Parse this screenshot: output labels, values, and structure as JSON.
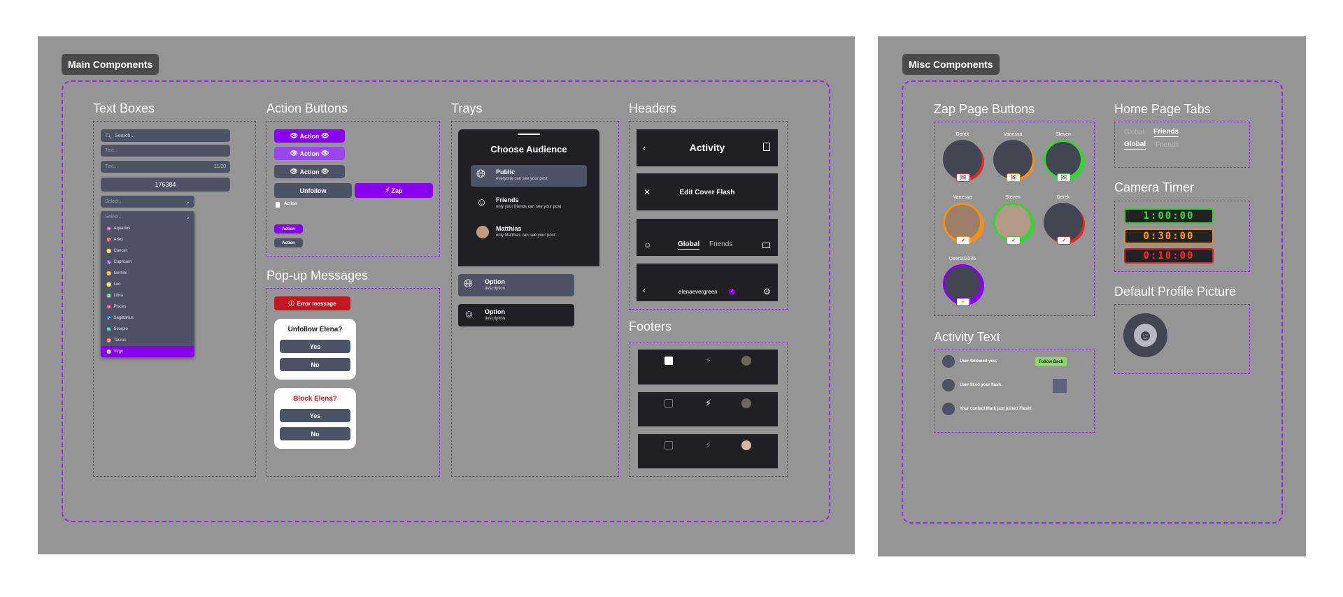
{
  "main": {
    "label": "Main Components",
    "text_boxes": {
      "title": "Text Boxes",
      "search_placeholder": "Search...",
      "text1_placeholder": "Text...",
      "text2_placeholder": "Text...",
      "counter": "11/20",
      "number_value": "176384",
      "select_placeholder": "Select...",
      "list_select_placeholder": "Select...",
      "options": [
        "Aquarius",
        "Aries",
        "Cancer",
        "Capricorn",
        "Gemini",
        "Leo",
        "Libra",
        "Pisces",
        "Sagittarius",
        "Scorpio",
        "Taurus",
        "Virgo"
      ],
      "option_icons": [
        "♒",
        "♈",
        "♋",
        "♑",
        "♊",
        "♌",
        "♎",
        "♓",
        "♐",
        "♏",
        "♉",
        "♍"
      ]
    },
    "action_buttons": {
      "title": "Action Buttons",
      "action1": "Action",
      "action2": "Action",
      "action3": "Action",
      "unfollow": "Unfollow",
      "zap": "Zap",
      "checkbox_label": "Action",
      "small_purple": "Action",
      "small_gray": "Action"
    },
    "popups": {
      "title": "Pop-up Messages",
      "error": "Error message",
      "unfollow_title": "Unfollow Elena?",
      "yes1": "Yes",
      "no1": "No",
      "block_title": "Block Elena?",
      "yes2": "Yes",
      "no2": "No"
    },
    "trays": {
      "title": "Trays",
      "heading": "Choose Audience",
      "items": [
        {
          "title": "Public",
          "desc": "everyone can see your post"
        },
        {
          "title": "Friends",
          "desc": "only your friends can see your post"
        },
        {
          "title": "Matthias",
          "desc": "only Matthias can see your post"
        }
      ],
      "option1_title": "Option",
      "option1_desc": "description",
      "option2_title": "Option",
      "option2_desc": "description"
    },
    "headers": {
      "title": "Headers",
      "activity": "Activity",
      "edit_cover": "Edit Cover Flash",
      "tab_global": "Global",
      "tab_friends": "Friends",
      "username": "elenaevergreen"
    },
    "footers": {
      "title": "Footers"
    }
  },
  "misc": {
    "label": "Misc Components",
    "zap": {
      "title": "Zap Page Buttons",
      "names": [
        "Derek",
        "Vanessa",
        "Steven",
        "Vanessa",
        "Steven",
        "Derek",
        "User103235"
      ]
    },
    "activity_text": {
      "title": "Activity Text",
      "line1": "User followed you.",
      "follow_back": "Follow Back",
      "line2": "User liked your flash.",
      "line3": "Your contact Mark just joined Flash!"
    },
    "home_tabs": {
      "title": "Home Page Tabs",
      "row1_global": "Global",
      "row1_friends": "Friends",
      "row2_global": "Global",
      "row2_friends": "Friends"
    },
    "camera_timer": {
      "title": "Camera Timer",
      "t1": "1:00:00",
      "t2": "0:30:00",
      "t3": "0:10:00"
    },
    "profile_picture": {
      "title": "Default Profile Picture"
    }
  },
  "colors": {
    "accent": "#8800ee",
    "dash": "#8b2cf0",
    "frame": "#959595",
    "dark": "#202024",
    "field": "#4d5264"
  }
}
